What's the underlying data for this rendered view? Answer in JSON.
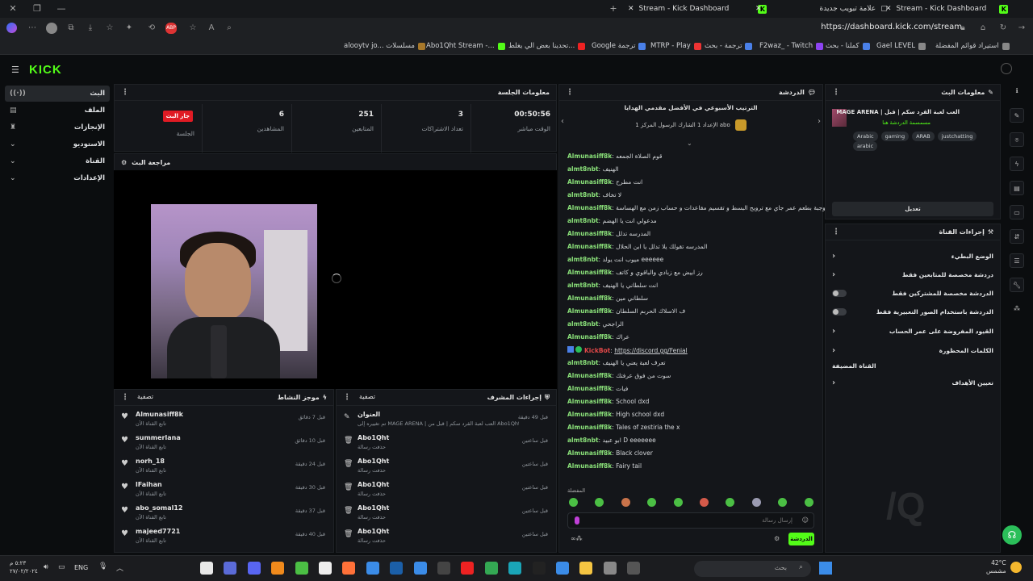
{
  "browser": {
    "tabs": [
      {
        "title": "Stream - Kick Dashboard",
        "active": true
      },
      {
        "title": "علامة تبويب جديدة",
        "active": false
      },
      {
        "title": "Stream - Kick Dashboard",
        "active": false
      }
    ],
    "url": "https://dashboard.kick.com/stream",
    "bookmarks": [
      "alooytv jo... مسلسلات",
      "Abo1Qht Stream -...",
      "تحدينا بعض الي يغلط...",
      "Google ترجمة",
      "MTRP - Play",
      "ترجمة - بحث",
      "F2waz_ - Twitch",
      "كملنا - بحث",
      "Gael LEVEL",
      "استيراد قوائم المفضلة"
    ]
  },
  "app": {
    "logo": "KICK"
  },
  "sidebar": {
    "items": [
      {
        "label": "البث",
        "icon": "broadcast-icon",
        "glyph": "((·))"
      },
      {
        "label": "الملف",
        "icon": "file-icon",
        "glyph": "▤"
      },
      {
        "label": "الإنجازات",
        "icon": "trophy-icon",
        "glyph": "♜"
      },
      {
        "label": "الاستوديو",
        "icon": "studio-icon",
        "glyph": "▣"
      },
      {
        "label": "القناة",
        "icon": "channel-icon",
        "glyph": "☷"
      },
      {
        "label": "الإعدادات",
        "icon": "settings-icon",
        "glyph": "⚙"
      }
    ]
  },
  "session": {
    "title": "معلومات الجلسة",
    "live_label": "جار البث",
    "session_label": "الجلسة",
    "stats": [
      {
        "value": "6",
        "label": "المشاهدين"
      },
      {
        "value": "251",
        "label": "المتابعين"
      },
      {
        "value": "3",
        "label": "تعداد الاشتراكات"
      },
      {
        "value": "00:50:56",
        "label": "الوقت مباشر"
      }
    ]
  },
  "preview": {
    "title": "مراجعة البث"
  },
  "activity": {
    "title": "موجز النشاط",
    "filter": "تصفية",
    "items": [
      {
        "user": "Almunasiff8k",
        "sub": "تابع القناة الآن",
        "time": "قبل 7 دقائق"
      },
      {
        "user": "summerlana",
        "sub": "تابع القناة الآن",
        "time": "قبل 10 دقائق"
      },
      {
        "user": "norh_18",
        "sub": "تابع القناة الآن",
        "time": "قبل 24 دقيقة"
      },
      {
        "user": "lFaihan",
        "sub": "تابع القناة الآن",
        "time": "قبل 30 دقيقة"
      },
      {
        "user": "abo_somal12",
        "sub": "تابع القناة الآن",
        "time": "قبل 37 دقيقة"
      },
      {
        "user": "majeed7721",
        "sub": "تابع القناة الآن",
        "time": "قبل 40 دقيقة"
      }
    ]
  },
  "modactions": {
    "title": "إجراءات المشرف",
    "filter": "تصفية",
    "items": [
      {
        "user": "العنوان",
        "sub": "تم تغييره إلى MAGE ARENA | العب لعبة القرد سكم | قبل من Abo1Qht",
        "time": "قبل 49 دقيقة"
      },
      {
        "user": "Abo1Qht",
        "sub": "حذفت رسالة",
        "time": "قبل ساعتين"
      },
      {
        "user": "Abo1Qht",
        "sub": "حذفت رسالة",
        "time": "قبل ساعتين"
      },
      {
        "user": "Abo1Qht",
        "sub": "حذفت رسالة",
        "time": "قبل ساعتين"
      },
      {
        "user": "Abo1Qht",
        "sub": "حذفت رسالة",
        "time": "قبل ساعتين"
      },
      {
        "user": "Abo1Qht",
        "sub": "حذفت رسالة",
        "time": "قبل ساعتين"
      }
    ]
  },
  "chat": {
    "title": "الدردشة",
    "pinned_title": "الترتيب الأسبوعي في الأفضل مقدمي الهدايا",
    "pinned_sub": "الإعداد 1 الشارك الرسول المركز 1 abo",
    "messages": [
      {
        "user": "Almunasiff8k",
        "text": "قوم الصلاة الجمعه"
      },
      {
        "user": "almt8nbt",
        "text": "الهنيف"
      },
      {
        "user": "Almunasiff8k",
        "text": "انت مطرح"
      },
      {
        "user": "almt8nbt",
        "text": "لا تخاف"
      },
      {
        "user": "Almunasiff8k",
        "text": "وجبة بطعم عمر جاي مع ترويح البسط و تقسيم مقاعدات و حساب زمن مع الهساسة"
      },
      {
        "user": "almt8nbt",
        "text": "مدعولي انت يا الهضم"
      },
      {
        "user": "Almunasiff8k",
        "text": "المدرسه تدلل"
      },
      {
        "user": "Almunasiff8k",
        "text": "المدرسه تقولك يلا تدلل يا ابن الحلال"
      },
      {
        "user": "almt8nbt",
        "text": "ميوب انت يولد eeeeee"
      },
      {
        "user": "Almunasiff8k",
        "text": "رز ابيض مع زبادي والباقوي و كاتف"
      },
      {
        "user": "almt8nbt",
        "text": "انت سلطاني يا الهنيف"
      },
      {
        "user": "Almunasiff8k",
        "text": "سلطاني مين"
      },
      {
        "user": "Almunasiff8k",
        "text": "ف الاسلاك الحربم السلطان"
      },
      {
        "user": "almt8nbt",
        "text": "الراجحي"
      },
      {
        "user": "Almunasiff8k",
        "text": "عراك"
      },
      {
        "user": "KickBot",
        "text": "https://discord.gg/Fenial",
        "bot": true
      },
      {
        "user": "almt8nbt",
        "text": "تعرف لعبة يعني يا الهنيف"
      },
      {
        "user": "Almunasiff8k",
        "text": "سوت من فوق عرفتك"
      },
      {
        "user": "Almunasiff8k",
        "text": "فيات"
      },
      {
        "user": "Almunasiff8k",
        "text": "School dxd"
      },
      {
        "user": "Almunasiff8k",
        "text": "High school dxd"
      },
      {
        "user": "Almunasiff8k",
        "text": "Tales of zestiria the x"
      },
      {
        "user": "almt8nbt",
        "text": "ابو عبيد D eeeeeee"
      },
      {
        "user": "Almunasiff8k",
        "text": "Black clover"
      },
      {
        "user": "Almunasiff8k",
        "text": "Fairy tail"
      }
    ],
    "emotes_label": "المفضلة",
    "input_placeholder": "إرسال رسالة",
    "send_label": "الدردشة"
  },
  "streaminfo": {
    "title": "معلومات البث",
    "stream_title": "MAGE ARENA | العب لعبة القرد سكم | قبل",
    "category": "مسمسمة الدردشة هنا",
    "tags": [
      "Arabic",
      "gaming",
      "ARAB",
      "justchatting",
      "arabic"
    ],
    "edit_label": "تعديل"
  },
  "channelactions": {
    "title": "إجراءات القناة",
    "items": [
      {
        "label": "الوضع البطيء",
        "kind": "arrow"
      },
      {
        "label": "دردشة مخصصة للمتابعين فقط",
        "kind": "arrow"
      },
      {
        "label": "الدردشة مخصصة للمشتركين فقط",
        "kind": "toggle"
      },
      {
        "label": "الدردشة باستخدام الصور التعبيرية فقط",
        "kind": "toggle"
      },
      {
        "label": "القيود المفروضة على عمر الحساب",
        "kind": "arrow"
      },
      {
        "label": "الكلمات المحظورة",
        "kind": "arrow"
      },
      {
        "label": "القناة المضيفة",
        "kind": "none"
      },
      {
        "label": "تعيين الأهداف",
        "kind": "arrow"
      }
    ]
  },
  "taskbar": {
    "search": "بحث",
    "lang": "ENG",
    "time": "٥:٢٣ م",
    "date": "٢٧/٠٢/٢٠٢٤",
    "weather_temp": "42°C",
    "weather_label": "مشمس"
  },
  "colors": {
    "accent": "#53fc18",
    "live": "#e01b24",
    "username": "#8be27a"
  }
}
